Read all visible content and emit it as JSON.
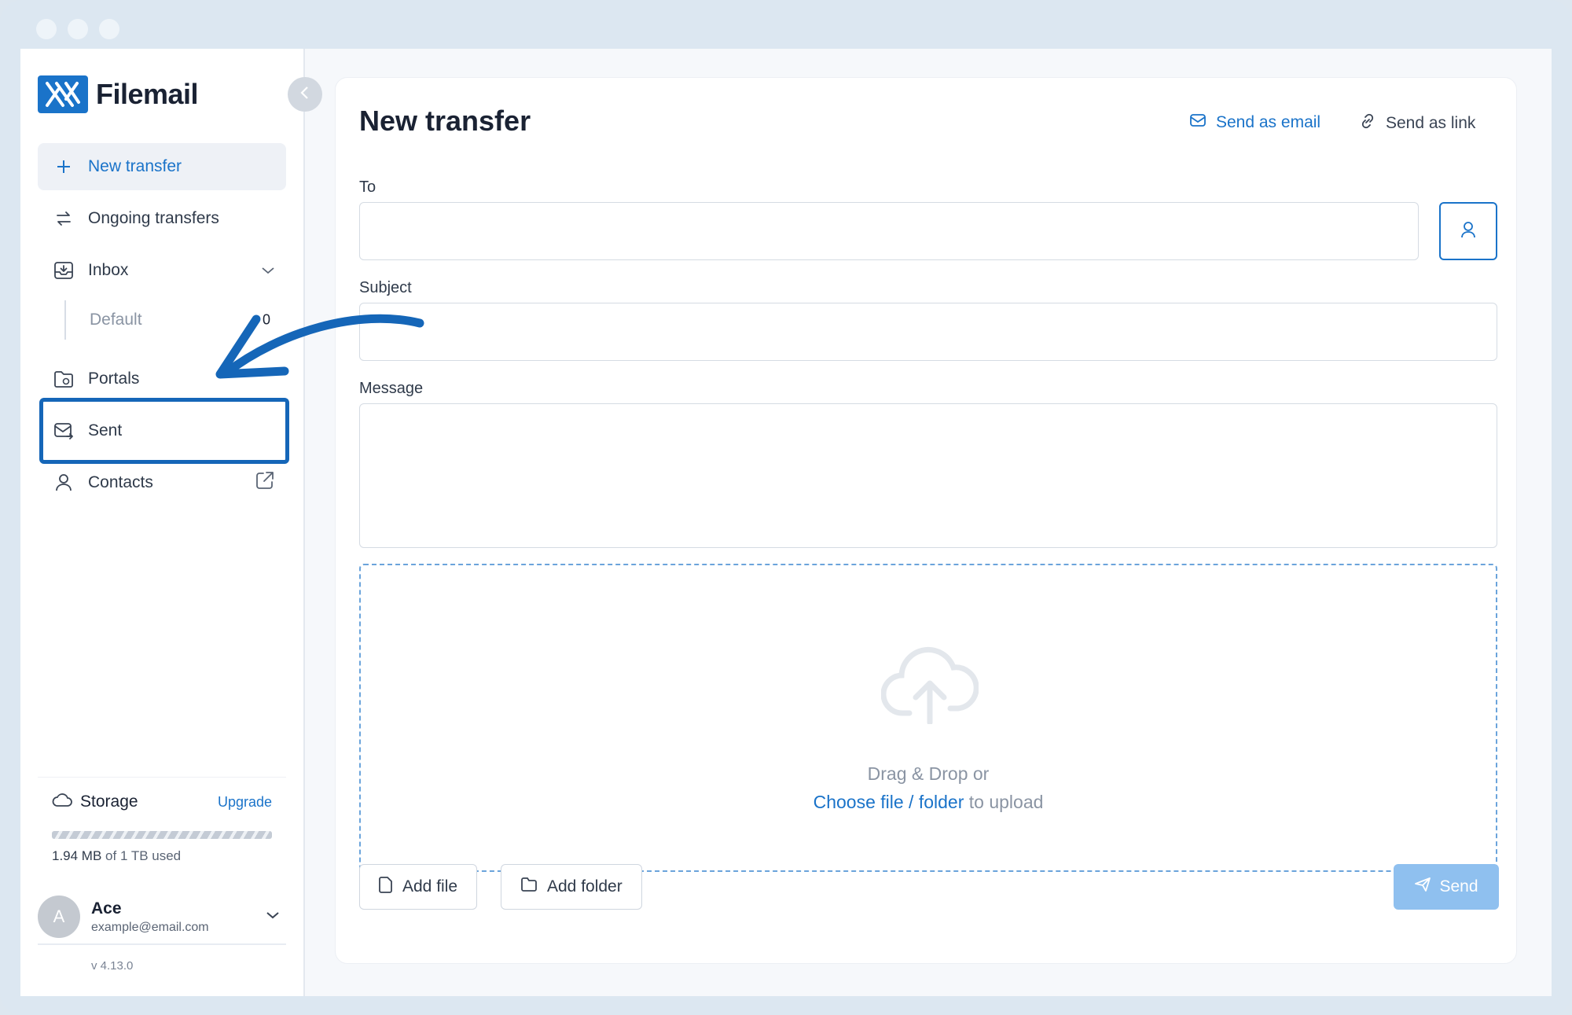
{
  "app": {
    "name": "Filemail",
    "version": "v 4.13.0"
  },
  "sidebar": {
    "collapse_icon": "chevron-left-icon",
    "items": [
      {
        "label": "New transfer",
        "icon": "plus-icon"
      },
      {
        "label": "Ongoing transfers",
        "icon": "swap-arrows-icon"
      },
      {
        "label": "Inbox",
        "icon": "inbox-icon"
      },
      {
        "label": "Portals",
        "icon": "portal-folder-icon"
      },
      {
        "label": "Sent",
        "icon": "sent-mail-icon"
      },
      {
        "label": "Contacts",
        "icon": "user-icon"
      }
    ],
    "inbox_sub": {
      "label": "Default",
      "count": "0"
    },
    "storage": {
      "title": "Storage",
      "upgrade": "Upgrade",
      "used": "1.94 MB",
      "total": "of 1 TB used"
    },
    "account": {
      "initial": "A",
      "name": "Ace",
      "email": "example@email.com"
    }
  },
  "main": {
    "title": "New transfer",
    "send_as_email": "Send as email",
    "send_as_link": "Send as link",
    "to_label": "To",
    "to_value": "",
    "subject_label": "Subject",
    "subject_value": "",
    "message_label": "Message",
    "message_value": "",
    "drop_text": "Drag & Drop or",
    "choose_file": "Choose file",
    "slash": "/",
    "folder": "folder",
    "to_upload": "to upload",
    "add_file": "Add file",
    "add_folder": "Add folder",
    "send": "Send"
  },
  "colors": {
    "accent": "#1a73c9",
    "highlight": "#1566b8",
    "send_disabled": "#8fc0ef"
  }
}
